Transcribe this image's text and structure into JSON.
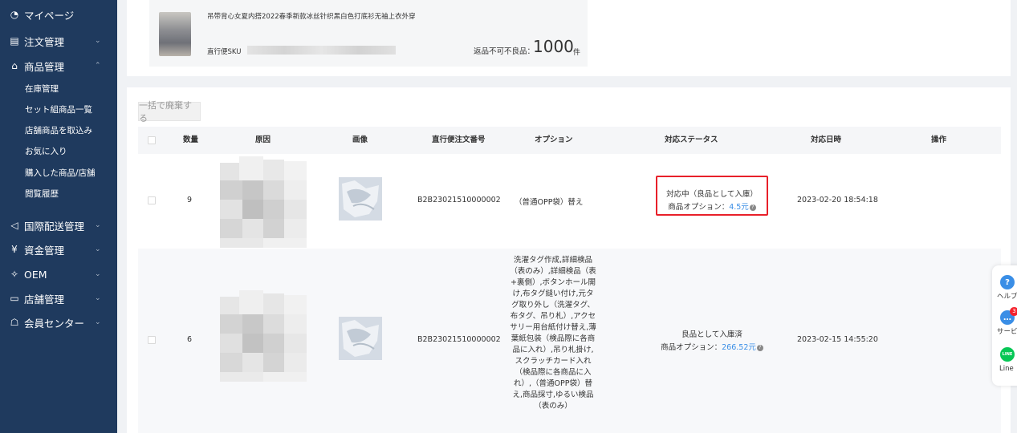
{
  "sidebar": {
    "items": [
      {
        "label": "マイページ",
        "icon": "clock-icon",
        "glyph": "◔",
        "chevron": ""
      },
      {
        "label": "注文管理",
        "icon": "order-list-icon",
        "glyph": "▤",
        "chevron": "⌄"
      },
      {
        "label": "商品管理",
        "icon": "shopping-bag-icon",
        "glyph": "⌂",
        "chevron": "⌃"
      },
      {
        "label": "国際配送管理",
        "icon": "send-icon",
        "glyph": "◁",
        "chevron": "⌄"
      },
      {
        "label": "資金管理",
        "icon": "yen-icon",
        "glyph": "¥",
        "chevron": "⌄"
      },
      {
        "label": "OEM",
        "icon": "oem-icon",
        "glyph": "✧",
        "chevron": "⌄"
      },
      {
        "label": "店舗管理",
        "icon": "store-icon",
        "glyph": "▭",
        "chevron": "⌄"
      },
      {
        "label": "会員センター",
        "icon": "member-icon",
        "glyph": "☖",
        "chevron": "⌄"
      }
    ],
    "sub_items": [
      "在庫管理",
      "セット組商品一覧",
      "店舗商品を取込み",
      "お気に入り",
      "購入した商品/店舗",
      "閲覧履歴"
    ]
  },
  "product": {
    "title": "吊带背心女夏内搭2022春季新款冰丝针织黑白色打底衫无袖上衣外穿",
    "sku_label": "直行便SKU",
    "return_label": "返品不可不良品：",
    "return_count": "1000",
    "return_unit": "件"
  },
  "toolbar": {
    "bulk_discard": "一括で廃棄する"
  },
  "table": {
    "headers": {
      "qty": "数量",
      "reason": "原因",
      "image": "画像",
      "order_no": "直行便注文番号",
      "option": "オプション",
      "status": "対応ステータス",
      "date": "対応日時",
      "action": "操作"
    },
    "rows": [
      {
        "qty": "9",
        "order_no": "B2B23021510000002",
        "option": "（普通OPP袋）替え",
        "status_line1": "対応中（良品として入庫）",
        "status_label": "商品オプション：",
        "status_price": "4.5元",
        "date": "2023-02-20 18:54:18"
      },
      {
        "qty": "6",
        "order_no": "B2B23021510000002",
        "option": "洗濯タグ作成,詳細検品（表のみ）,詳細検品（表+裏側）,ボタンホール開け,布タグ縫い付け,元タグ取り外し（洗濯タグ、布タグ、吊り札）,アクセサリー用台紙付け替え,薄葉紙包装（検品際に各商品に入れ）,吊り札掛け,スクラッチカード入れ（検品際に各商品に入れ）,（普通OPP袋）替え,商品採寸,ゆるい検品（表のみ）",
        "status_line1": "良品として入庫済",
        "status_label": "商品オプション：",
        "status_price": "266.52元",
        "date": "2023-02-15 14:55:20"
      }
    ]
  },
  "float_panel": {
    "help": "ヘルプ",
    "service": "サービス",
    "service_badge": "3",
    "line": "Line",
    "line_icon_text": "LINE"
  },
  "colors": {
    "sidebar_bg": "#1f3a5e",
    "link": "#3a8ee6",
    "highlight_border": "#e8202a",
    "line_green": "#06c755",
    "help_blue": "#3a8ee6"
  }
}
